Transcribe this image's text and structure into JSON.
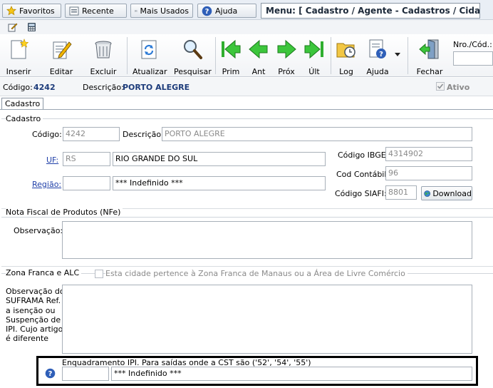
{
  "topbar": {
    "favoritos": "Favoritos",
    "recente": "Recente",
    "mais_usados": "Mais Usados",
    "ajuda": "Ajuda",
    "menu_title": "Menu: [ Cadastro / Agente - Cadastros / Cidade]"
  },
  "toolbar": {
    "inserir": "Inserir",
    "editar": "Editar",
    "excluir": "Excluir",
    "atualizar": "Atualizar",
    "pesquisar": "Pesquisar",
    "prim": "Prim",
    "ant": "Ant",
    "prox": "Próx",
    "ult": "Últ",
    "log": "Log",
    "ajuda": "Ajuda",
    "fechar": "Fechar",
    "nro_cod_label": "Nro./Cód.:"
  },
  "info": {
    "codigo_label": "Código:",
    "codigo_value": "4242",
    "descricao_label": "Descrição:",
    "descricao_value": "PORTO ALEGRE",
    "ativo_label": "Ativo"
  },
  "tabs": {
    "cadastro": "Cadastro"
  },
  "cadastro": {
    "section": "Cadastro",
    "codigo_label": "Código:",
    "codigo_value": "4242",
    "descricao_label": "Descrição:",
    "descricao_value": "PORTO ALEGRE",
    "uf_label": "UF:",
    "uf_value": "RS",
    "uf_name": "RIO GRANDE DO SUL",
    "regiao_label": "Região:",
    "regiao_value": "",
    "regiao_name": "*** Indefinido ***",
    "ibge_label": "Código IBGE:",
    "ibge_value": "4314902",
    "contabil_label": "Cod Contábil:",
    "contabil_value": "96",
    "siafi_label": "Código SIAFI:",
    "siafi_value": "8801",
    "download": "Download"
  },
  "nfe": {
    "section": "Nota Fiscal de Produtos (NFe)",
    "obs_label": "Observação:",
    "obs_value": ""
  },
  "zona": {
    "section": "Zona Franca e ALC",
    "checkbox_label": "Esta cidade pertence à Zona Franca de Manaus ou a Área de Livre Comércio",
    "obs_label_1": "Observação do",
    "obs_label_2": "SUFRAMA Ref.",
    "obs_label_3": "a isenção ou",
    "obs_label_4": "Suspenção de",
    "obs_label_5": "IPI. Cujo artigo",
    "obs_label_6": "é diferente",
    "enquadramento_label": "Enquadramento IPI. Para saídas onde a CST são ('52', '54', '55')",
    "enquadramento_code": "",
    "enquadramento_name": "*** Indefinido ***"
  }
}
